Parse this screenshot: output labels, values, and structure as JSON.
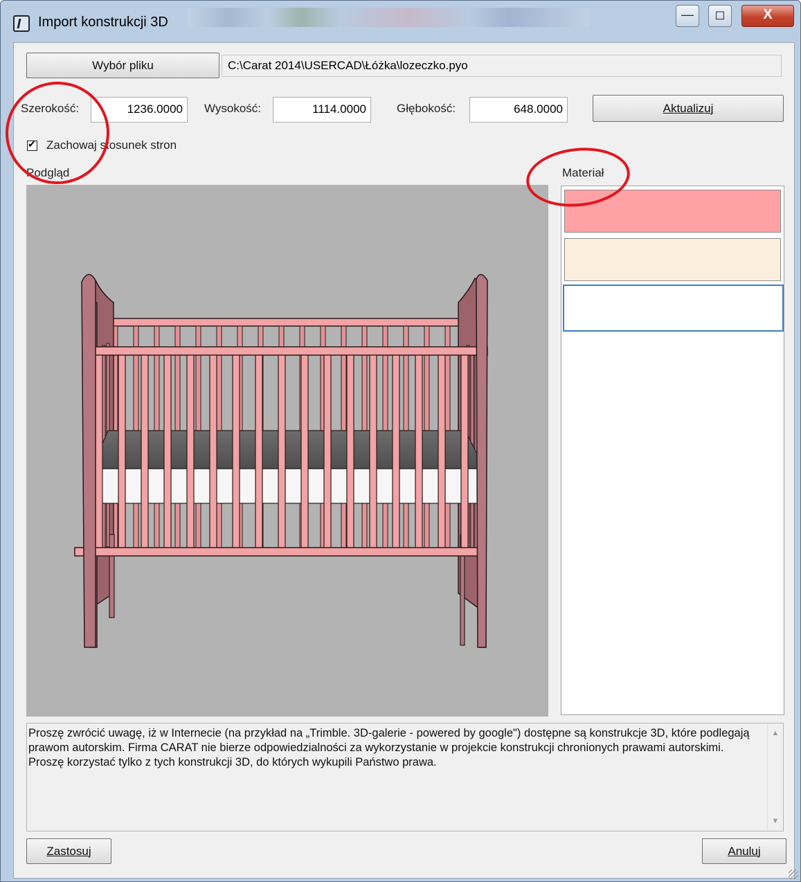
{
  "window": {
    "title": "Import konstrukcji 3D",
    "minimize_glyph": "—",
    "maximize_glyph": "◻",
    "close_glyph": "X"
  },
  "file": {
    "button_label": "Wybór pliku",
    "path": "C:\\Carat 2014\\USERCAD\\Łóżka\\lozeczko.pyo"
  },
  "dimensions": {
    "width_label": "Szerokość:",
    "width_value": "1236.0000",
    "height_label": "Wysokość:",
    "height_value": "1114.0000",
    "depth_label": "Głębokość:",
    "depth_value": "648.0000",
    "update_button": "Aktualizuj"
  },
  "keep_ratio": {
    "label": "Zachowaj stosunek stron",
    "checked": true
  },
  "preview": {
    "label": "Podgląd",
    "background": "#b3b3b3"
  },
  "material": {
    "label": "Materiał",
    "swatches": [
      {
        "color": "#ffa1a5"
      },
      {
        "color": "#fbeedd"
      },
      {
        "color": "#ffffff",
        "selected": true
      }
    ]
  },
  "notice": {
    "text": "Proszę zwrócić uwagę, iż w Internecie (na przykład na „Trimble. 3D-galerie - powered by google\") dostępne są konstrukcje 3D, które podlegają prawom autorskim. Firma CARAT nie bierze odpowiedzialności za wykorzystanie w projekcie konstrukcji chronionych prawami autorskimi.\nProszę korzystać tylko z tych konstrukcji 3D, do których wykupili Państwo prawa."
  },
  "footer": {
    "apply_button": "Zastosuj",
    "cancel_button": "Anuluj"
  },
  "colors": {
    "crib_rail": "#f2a3a6",
    "crib_post": "#a66b72",
    "annotation": "#e0161f"
  }
}
